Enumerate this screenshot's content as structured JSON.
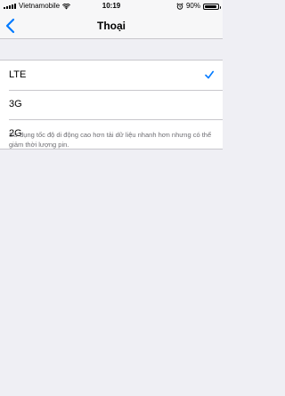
{
  "status_bar": {
    "carrier": "Vietnamobile",
    "time": "10:19",
    "battery_percent": "90%",
    "battery_level": 0.9,
    "icons": [
      "signal-icon",
      "wifi-icon",
      "alarm-icon",
      "battery-icon"
    ]
  },
  "nav": {
    "title": "Thoại",
    "back_icon": "chevron-left-icon",
    "accent_color": "#007aff"
  },
  "options": [
    {
      "label": "LTE",
      "selected": true
    },
    {
      "label": "3G",
      "selected": false
    },
    {
      "label": "2G",
      "selected": false
    }
  ],
  "footer_text": "Sử dụng tốc độ di động cao hơn tải dữ liệu nhanh hơn nhưng có thể giảm thời lượng pin."
}
